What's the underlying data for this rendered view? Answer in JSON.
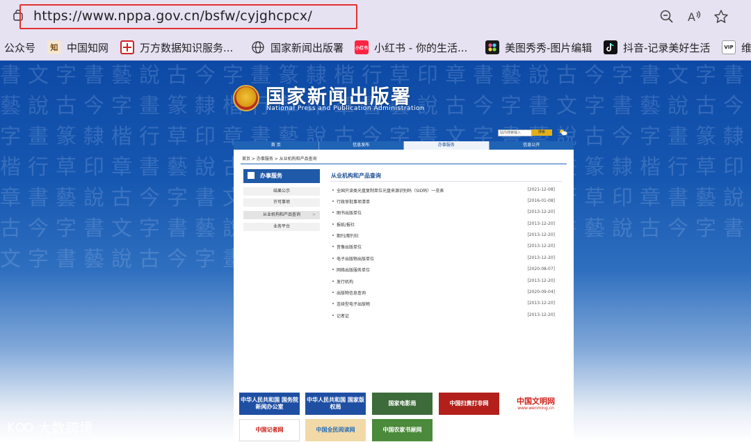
{
  "browser": {
    "url": "https://www.nppa.gov.cn/bsfw/cyjghcpcx/",
    "icons": [
      "tab-icon",
      "zoom-out-icon",
      "read-aloud-icon",
      "favorite-star-icon"
    ]
  },
  "bookmarks": [
    {
      "label": "公众号"
    },
    {
      "label": "中国知网",
      "icon_text": "知"
    },
    {
      "label": "万方数据知识服务..."
    },
    {
      "label": "国家新闻出版署"
    },
    {
      "label": "小红书 - 你的生活...",
      "icon_text": "小红书"
    },
    {
      "label": "美图秀秀-图片编辑"
    },
    {
      "label": "抖音-记录美好生活"
    },
    {
      "label": "维",
      "icon_text": "VIP"
    }
  ],
  "site": {
    "title": "国家新闻出版署",
    "subtitle": "National Press and Publication Administration",
    "search_placeholder": "站内搜索输入",
    "search_button": "搜索"
  },
  "nav": [
    "首 页",
    "信息发布",
    "办事服务",
    "信息公开"
  ],
  "breadcrumb": "首页 > 办事服务 > 从业机构和产品查询",
  "sidebar": {
    "title": "办事服务",
    "items": [
      {
        "label": "结果公示"
      },
      {
        "label": "许可事项"
      },
      {
        "label": "从业机构和产品查询"
      },
      {
        "label": "业务平台"
      }
    ]
  },
  "main": {
    "title": "从业机构和产品查询",
    "rows": [
      {
        "title": "全国只读类光盘复制单位光盘来源识别码（SID码）一览表",
        "date": "[2021-12-08]"
      },
      {
        "title": "行政审批事项清单",
        "date": "[2016-01-08]"
      },
      {
        "title": "图书出版单位",
        "date": "[2013-12-20]"
      },
      {
        "title": "报纸/报社",
        "date": "[2013-12-20]"
      },
      {
        "title": "期刊/期刊社",
        "date": "[2013-12-20]"
      },
      {
        "title": "音像出版单位",
        "date": "[2013-12-20]"
      },
      {
        "title": "电子出版物出版单位",
        "date": "[2013-12-20]"
      },
      {
        "title": "网络出版服务单位",
        "date": "[2020-08-07]"
      },
      {
        "title": "发行机构",
        "date": "[2013-12-20]"
      },
      {
        "title": "出版物信息查询",
        "date": "[2020-09-04]"
      },
      {
        "title": "连续型电子出版物",
        "date": "[2013-12-20]"
      },
      {
        "title": "记者证",
        "date": "[2013-12-20]"
      }
    ]
  },
  "footer_links": [
    {
      "label": "中华人民共和国 国务院新闻办公室",
      "color": "#1e4fa3"
    },
    {
      "label": "中华人民共和国 国家版权局",
      "color": "#1e4fa3"
    },
    {
      "label": "国家电影局",
      "color": "#3d6b3a"
    },
    {
      "label": "中国扫黄打非网",
      "color": "#b3201b"
    },
    {
      "label": "中国文明网",
      "sub": "www.wenming.cn",
      "color": "#d0201a"
    },
    {
      "label": "中国记者网",
      "color": "#c9201a"
    },
    {
      "label": "中国全民阅读网",
      "color": "#2a6fb5"
    },
    {
      "label": "中国农家书屋网",
      "color": "#4a8a3a"
    }
  ],
  "watermark": "大数跨境"
}
